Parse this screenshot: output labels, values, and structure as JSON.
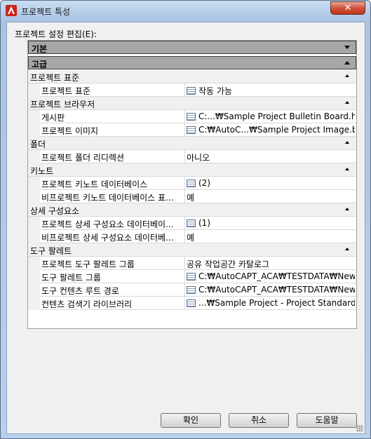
{
  "window": {
    "title": "프로젝트 특성",
    "close_glyph": "✕"
  },
  "edit_label": "프로젝트 설정 편집(E):",
  "sections": {
    "basic": "기본",
    "advanced": "고급"
  },
  "categories": {
    "standards": "프로젝트 표준",
    "browser": "프로젝트 브라우저",
    "folders": "폴더",
    "keynotes": "키노트",
    "details": "상세 구성요소",
    "palettes": "도구 팔레트"
  },
  "props": {
    "standards_name": "프로젝트 표준",
    "standards_val": "작동 가능",
    "bulletin_name": "게시판",
    "bulletin_val": "C:...₩Sample Project Bulletin Board.htm",
    "image_name": "프로젝트 이미지",
    "image_val": "C:₩AutoC...₩Sample Project Image.bmp",
    "folder_name": "프로젝트 폴더 리디렉션",
    "folder_val": "아니오",
    "keynote_db_name": "프로젝트 키노트 데이터베이스",
    "keynote_db_val": "(2)",
    "nonproj_keynote_name": "비프로젝트 키노트 데이터베이스 표...",
    "nonproj_keynote_val": "예",
    "detail_db_name": "프로젝트 상세 구성요소 데이터베이...",
    "detail_db_val": "(1)",
    "nonproj_detail_name": "비프로젝트 상세 구성요소 데이터베...",
    "nonproj_detail_val": "예",
    "palette_group_name": "프로젝트 도구 팔레트 그룹",
    "palette_group_val": "공유 작업공간 카탈로그",
    "palette_name": "도구 팔레트 그룹",
    "palette_val": "C:₩AutoCAPT_ACA₩TESTDATA₩New...₩",
    "content_root_name": "도구 컨텐츠 루트 경로",
    "content_root_val": "C:₩AutoCAPT_ACA₩TESTDATA₩New...₩",
    "browser_lib_name": "컨텐츠 검색기 라이브러리",
    "browser_lib_val": "...₩Sample Project - Project Standards...."
  },
  "buttons": {
    "ok": "확인",
    "cancel": "취소",
    "help": "도움말"
  },
  "colors": {
    "close_red": "#c0331c",
    "header_gray": "#a6a6a6",
    "frame_blue": "#b9d0ec"
  },
  "icons": {
    "app": "autocad-a-icon",
    "value": "list-icon"
  }
}
